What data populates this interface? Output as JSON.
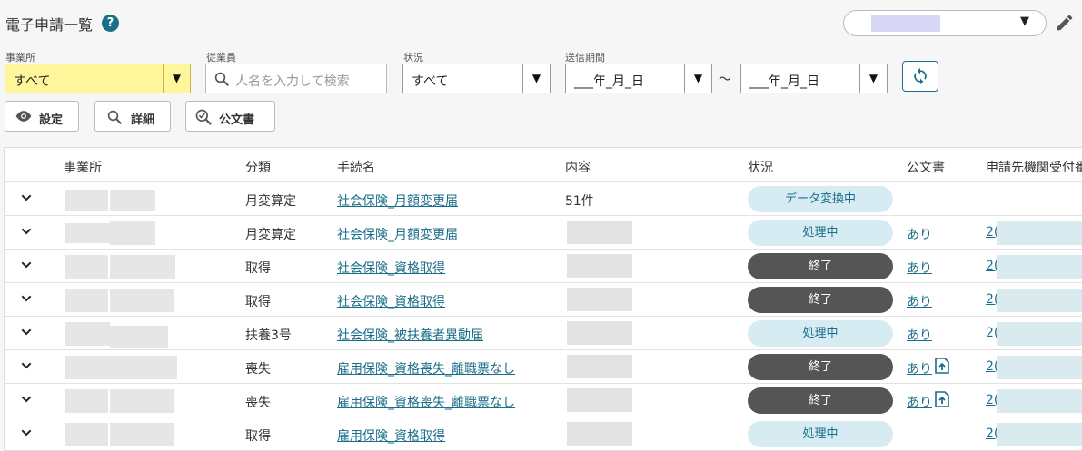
{
  "header": {
    "title": "電子申請一覧",
    "help_icon": "help-icon",
    "help_glyph": "?"
  },
  "top_selector": {
    "arrow": "▼"
  },
  "filters": {
    "office": {
      "label": "事業所",
      "value": "すべて",
      "arrow": "▼"
    },
    "employee": {
      "label": "従業員",
      "placeholder": "人名を入力して検索"
    },
    "status": {
      "label": "状況",
      "value": "すべて",
      "arrow": "▼"
    },
    "period": {
      "label": "送信期間",
      "from": "___年_月_日",
      "to": "___年_月_日",
      "separator": "～",
      "arrow": "▼"
    }
  },
  "buttons": {
    "settings": "設定",
    "details": "詳細",
    "official": "公文書"
  },
  "table": {
    "columns": [
      "事業所",
      "分類",
      "手続名",
      "内容",
      "状況",
      "公文書",
      "申請先機関受付番号"
    ],
    "rows": [
      {
        "category": "月変算定",
        "procedure": "社会保険_月額変更届",
        "content": "51件",
        "status": "データ変換中",
        "status_style": "light",
        "official": "",
        "upload": false,
        "receipt": ""
      },
      {
        "category": "月変算定",
        "procedure": "社会保険_月額変更届",
        "content": "",
        "status": "処理中",
        "status_style": "light",
        "official": "あり",
        "upload": false,
        "receipt": "2("
      },
      {
        "category": "取得",
        "procedure": "社会保険_資格取得",
        "content": "",
        "status": "終了",
        "status_style": "dark",
        "official": "あり",
        "upload": false,
        "receipt": "2("
      },
      {
        "category": "取得",
        "procedure": "社会保険_資格取得",
        "content": "",
        "status": "終了",
        "status_style": "dark",
        "official": "あり",
        "upload": false,
        "receipt": "2("
      },
      {
        "category": "扶養3号",
        "procedure": "社会保険_被扶養者異動届",
        "content": "",
        "status": "処理中",
        "status_style": "light",
        "official": "あり",
        "upload": false,
        "receipt": "2("
      },
      {
        "category": "喪失",
        "procedure": "雇用保険_資格喪失_離職票なし",
        "content": "",
        "status": "終了",
        "status_style": "dark",
        "official": "あり",
        "upload": true,
        "receipt": "2("
      },
      {
        "category": "喪失",
        "procedure": "雇用保険_資格喪失_離職票なし",
        "content": "",
        "status": "終了",
        "status_style": "dark",
        "official": "あり",
        "upload": true,
        "receipt": "2("
      },
      {
        "category": "取得",
        "procedure": "雇用保険_資格取得",
        "content": "",
        "status": "処理中",
        "status_style": "light",
        "official": "",
        "upload": false,
        "receipt": "2("
      }
    ]
  },
  "colors": {
    "accent": "#1b6e8a",
    "pill_light": "#d7ecf2",
    "pill_dark": "#555555",
    "office_highlight": "#fff59a"
  }
}
